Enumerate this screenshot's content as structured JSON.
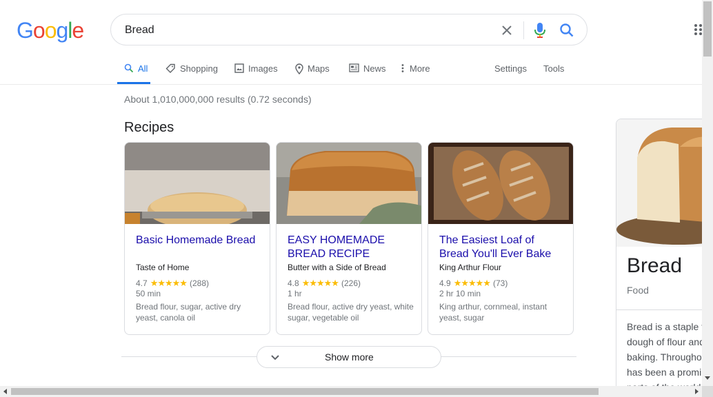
{
  "logo": [
    "G",
    "o",
    "o",
    "g",
    "l",
    "e"
  ],
  "search": {
    "value": "Bread"
  },
  "tabs": [
    {
      "label": "All",
      "icon": "search-icon"
    },
    {
      "label": "Shopping",
      "icon": "tag-icon"
    },
    {
      "label": "Images",
      "icon": "image-icon"
    },
    {
      "label": "Maps",
      "icon": "map-pin-icon"
    },
    {
      "label": "News",
      "icon": "newspaper-icon"
    },
    {
      "label": "More",
      "icon": "more-vert-icon"
    }
  ],
  "tools": {
    "settings": "Settings",
    "tools": "Tools"
  },
  "result_stats": "About 1,010,000,000 results (0.72 seconds)",
  "recipes": {
    "title": "Recipes",
    "cards": [
      {
        "title": "Basic Homemade Bread",
        "source": "Taste of Home",
        "rating": "4.7",
        "stars": "★★★★★",
        "reviews": "(288)",
        "time": "50 min",
        "ingredients": "Bread flour, sugar, active dry yeast, canola oil"
      },
      {
        "title": "EASY HOMEMADE BREAD RECIPE",
        "source": "Butter with a Side of Bread",
        "rating": "4.8",
        "stars": "★★★★★",
        "reviews": "(226)",
        "time": "1 hr",
        "ingredients": "Bread flour, active dry yeast, white sugar, vegetable oil"
      },
      {
        "title": "The Easiest Loaf of Bread You'll Ever Bake",
        "source": "King Arthur Flour",
        "rating": "4.9",
        "stars": "★★★★★",
        "reviews": "(73)",
        "time": "2 hr 10 min",
        "ingredients": "King arthur, cornmeal, instant yeast, sugar"
      }
    ],
    "show_more": "Show more"
  },
  "knowledge_panel": {
    "title": "Bread",
    "subtitle": "Food",
    "description_lines": [
      "Bread is a staple f",
      "dough of flour and",
      "baking. Througho",
      "has been a promi",
      "parts of the world"
    ]
  },
  "colors": {
    "link": "#1a0dab",
    "accent": "#1a73e8",
    "star": "#fbbc04"
  }
}
